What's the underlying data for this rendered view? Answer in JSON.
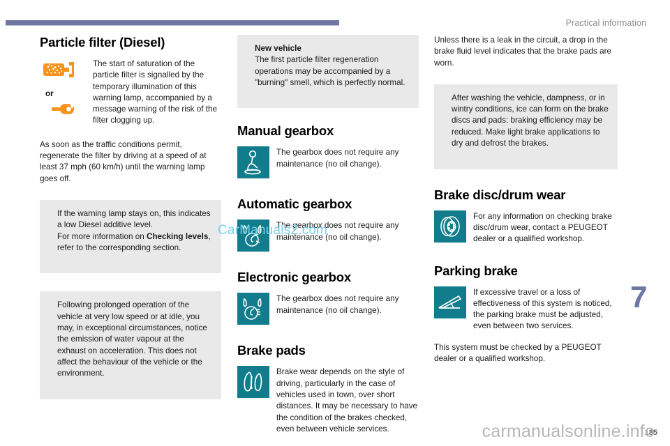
{
  "header": {
    "title": "Practical information",
    "rule_color": "#6d76a4"
  },
  "chapter": {
    "number": "7",
    "color": "#6d76a4"
  },
  "footer": {
    "page_number": "185",
    "watermark_bottom": "carmanualsonline.info",
    "watermark_middle": "CarManuals2.com"
  },
  "colors": {
    "teal_icon": "#107c8c",
    "orange_icon": "#f7941e",
    "info_blue": "#1b9bd8",
    "info_bg": "#e9e9e9"
  },
  "column1": {
    "section_title": "Particle filter (Diesel)",
    "or_label": "or",
    "icon1_name": "particle-filter-warning-icon",
    "icon2_name": "service-spanner-warning-icon",
    "icon_text": "The start of saturation of the particle filter is signalled by the temporary illumination of this warning lamp, accompanied by a message warning of the risk of the filter clogging up.",
    "paragraph": "As soon as the traffic conditions permit, regenerate the filter by driving at a speed of at least 37 mph (60 km/h) until the warning lamp goes off.",
    "info1_line1": "If the warning lamp stays on, this indicates a low Diesel additive level.",
    "info1_line2_pre": "For more information on ",
    "info1_line2_bold": "Checking levels",
    "info1_line2_post": ", refer to the corresponding section.",
    "info2": "Following prolonged operation of the vehicle at very low speed or at idle, you may, in exceptional circumstances, notice the emission of water vapour at the exhaust on acceleration. This does not affect the behaviour of the vehicle or the environment."
  },
  "column2": {
    "info_new_vehicle_title": "New vehicle",
    "info_new_vehicle_text": "The first particle filter regeneration operations may be accompanied by a \"burning\" smell, which is perfectly normal.",
    "manual_gearbox_title": "Manual gearbox",
    "manual_gearbox_text": "The gearbox does not require any maintenance (no oil change).",
    "manual_gearbox_icon": "manual-gear-lever-icon",
    "automatic_gearbox_title": "Automatic gearbox",
    "automatic_gearbox_text": "The gearbox does not require any maintenance (no oil change).",
    "automatic_gearbox_icon": "automatic-gear-selector-icon",
    "electronic_gearbox_title": "Electronic gearbox",
    "electronic_gearbox_text": "The gearbox does not require any maintenance (no oil change).",
    "electronic_gearbox_icon": "electronic-gear-selector-icon",
    "brake_pads_title": "Brake pads",
    "brake_pads_text": "Brake wear depends on the style of driving, particularly in the case of vehicles used in town, over short distances. It may be necessary to have the condition of the brakes checked, even between vehicle services.",
    "brake_pads_icon": "brake-pads-icon"
  },
  "column3": {
    "intro_paragraph": "Unless there is a leak in the circuit, a drop in the brake fluid level indicates that the brake pads are worn.",
    "info_text": "After washing the vehicle, dampness, or in wintry conditions, ice can form on the brake discs and pads: braking efficiency may be reduced. Make light brake applications to dry and defrost the brakes.",
    "brake_disc_title": "Brake disc/drum wear",
    "brake_disc_text": "For any information on checking brake disc/drum wear, contact a PEUGEOT dealer or a qualified workshop.",
    "brake_disc_icon": "brake-disc-drum-icon",
    "parking_brake_title": "Parking brake",
    "parking_brake_text": "If excessive travel or a loss of effectiveness of this system is noticed, the parking brake must be adjusted, even between two services.",
    "parking_brake_icon": "parking-brake-lever-icon",
    "closing_paragraph": "This system must be checked by a PEUGEOT dealer or a qualified workshop."
  }
}
